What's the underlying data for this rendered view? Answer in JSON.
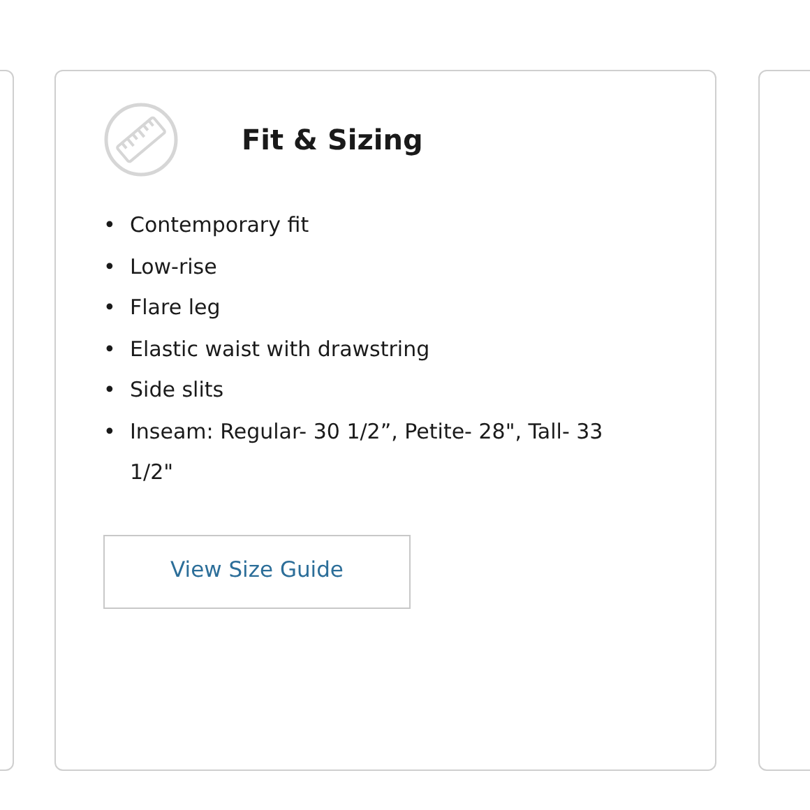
{
  "title": "Fit & Sizing",
  "features": [
    {
      "bullet": "•",
      "text": "Contemporary fit"
    },
    {
      "bullet": "•",
      "text": "Low-rise"
    },
    {
      "bullet": "•",
      "text": "Flare leg"
    },
    {
      "bullet": "•",
      "text": "Elastic waist with drawstring"
    },
    {
      "bullet": "•",
      "text": "Side slits"
    },
    {
      "bullet": "•",
      "text": "Inseam: Regular- 30 1/2”, Petite- 28\", Tall- 33 1/2\""
    }
  ],
  "button": "View Size Guide"
}
